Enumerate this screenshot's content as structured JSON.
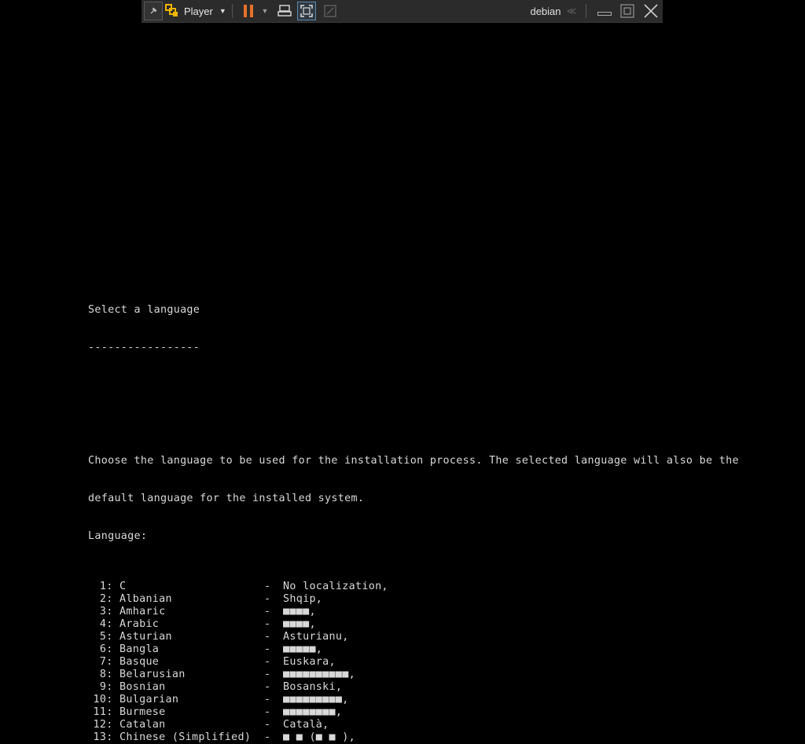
{
  "toolbar": {
    "player_label": "Player",
    "vm_name": "debian",
    "icons": {
      "pin": "pin-icon",
      "logo": "vmware-logo-icon",
      "pause": "pause-icon",
      "send_keys": "send-ctrl-alt-del-icon",
      "fullscreen": "fullscreen-icon",
      "unity": "unity-icon",
      "minimize": "minimize-icon",
      "restore": "restore-icon",
      "close": "close-icon"
    },
    "colors": {
      "pause": "#e8702a",
      "logo": "#f0b400"
    }
  },
  "console": {
    "title": "Select a language",
    "underline": "-----------------",
    "description_line1": "Choose the language to be used for the installation process. The selected language will also be the",
    "description_line2": "default language for the installed system.",
    "prompt": "Language:",
    "languages": [
      {
        "num": "1:",
        "name": "C",
        "native": "No localization,"
      },
      {
        "num": "2:",
        "name": "Albanian",
        "native": "Shqip,"
      },
      {
        "num": "3:",
        "name": "Amharic",
        "native": "■■■■,"
      },
      {
        "num": "4:",
        "name": "Arabic",
        "native": "■■■■,"
      },
      {
        "num": "5:",
        "name": "Asturian",
        "native": "Asturianu,"
      },
      {
        "num": "6:",
        "name": "Bangla",
        "native": "■■■■■,"
      },
      {
        "num": "7:",
        "name": "Basque",
        "native": "Euskara,"
      },
      {
        "num": "8:",
        "name": "Belarusian",
        "native": "■■■■■■■■■■,"
      },
      {
        "num": "9:",
        "name": "Bosnian",
        "native": "Bosanski,"
      },
      {
        "num": "10:",
        "name": "Bulgarian",
        "native": "■■■■■■■■■,"
      },
      {
        "num": "11:",
        "name": "Burmese",
        "native": "■■■■■■■■,"
      },
      {
        "num": "12:",
        "name": "Catalan",
        "native": "Català,"
      },
      {
        "num": "13:",
        "name": "Chinese (Simplified)",
        "native": "■ ■ (■ ■ ),"
      }
    ],
    "dash": "-"
  }
}
